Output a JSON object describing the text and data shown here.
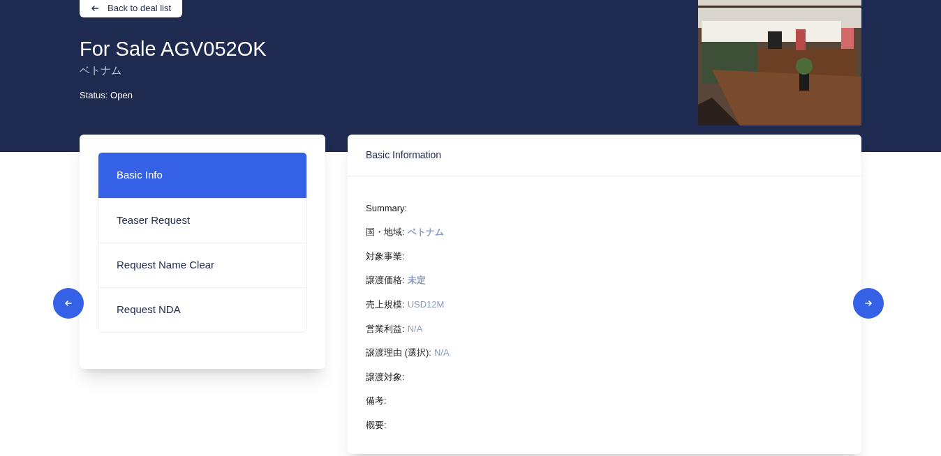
{
  "back_button": {
    "label": "Back to deal list"
  },
  "title": "For Sale AGV052OK",
  "subtitle": "ベトナム",
  "status": "Status: Open",
  "tabs": [
    {
      "label": "Basic Info",
      "selected": true
    },
    {
      "label": "Teaser Request",
      "selected": false
    },
    {
      "label": "Request Name Clear",
      "selected": false
    },
    {
      "label": "Request NDA",
      "selected": false
    }
  ],
  "panel": {
    "title": "Basic Information",
    "fields": [
      {
        "label": "Summary:"
      },
      {
        "label": "国・地域:",
        "value": "ベトナム",
        "emphasis": true
      },
      {
        "label": "対象事業:"
      },
      {
        "label": "譲渡価格:",
        "value": "未定",
        "emphasis": true
      },
      {
        "label": "売上規模:",
        "value": "USD12M"
      },
      {
        "label": "営業利益:",
        "value": "N/A"
      },
      {
        "label": "譲渡理由 (選択):",
        "value": "N/A"
      },
      {
        "label": "譲渡対象:"
      },
      {
        "label": "備考:"
      },
      {
        "label": "概要:"
      }
    ]
  }
}
